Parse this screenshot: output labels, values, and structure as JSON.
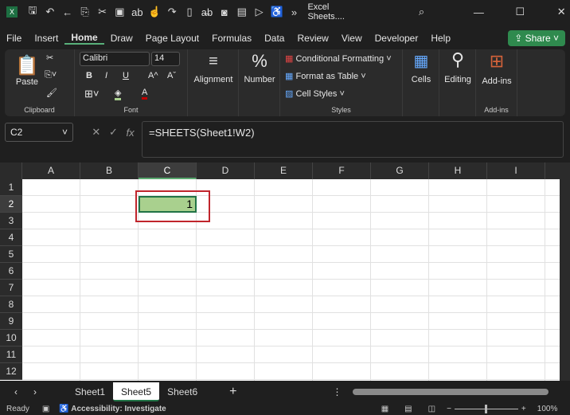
{
  "title_bar": {
    "app_icon": "excel-icon",
    "title": "Excel Sheets....",
    "quick_access": [
      "save-icon",
      "undo-icon",
      "back-icon",
      "copy-icon",
      "cut-icon",
      "image-icon",
      "spelling-icon",
      "touch-icon",
      "redo-icon",
      "new-icon",
      "strikethrough-icon",
      "camera-icon",
      "form-icon",
      "format-icon",
      "accessibility-icon"
    ],
    "more": "»"
  },
  "menu": {
    "items": [
      "File",
      "Insert",
      "Home",
      "Draw",
      "Page Layout",
      "Formulas",
      "Data",
      "Review",
      "View",
      "Developer",
      "Help"
    ],
    "active": "Home",
    "share": "Share"
  },
  "ribbon": {
    "clipboard": {
      "paste": "Paste",
      "label": "Clipboard"
    },
    "font": {
      "name": "Calibri",
      "size": "14",
      "bold": "B",
      "italic": "I",
      "underline": "U",
      "grow": "A^",
      "shrink": "Aˇ",
      "font_color": "A",
      "label": "Font",
      "fill_color": "#a9d08e",
      "text_color": "#c00000"
    },
    "alignment": "Alignment",
    "number": "Number",
    "styles": {
      "items": [
        "Conditional Formatting",
        "Format as Table",
        "Cell Styles"
      ],
      "label": "Styles"
    },
    "cells": "Cells",
    "editing": "Editing",
    "addins": {
      "button": "Add-ins",
      "label": "Add-ins"
    }
  },
  "formula_bar": {
    "name_box": "C2",
    "formula": "=SHEETS(Sheet1!W2)",
    "fx": "fx"
  },
  "grid": {
    "columns": [
      "A",
      "B",
      "C",
      "D",
      "E",
      "F",
      "G",
      "H",
      "I"
    ],
    "rows": [
      "1",
      "2",
      "3",
      "4",
      "5",
      "6",
      "7",
      "8",
      "9",
      "10",
      "11",
      "12"
    ],
    "selected_cell": "C2",
    "cell_value": "1",
    "highlight_color": "#c0252c"
  },
  "sheets": {
    "tabs": [
      "Sheet1",
      "Sheet5",
      "Sheet6"
    ],
    "active": "Sheet5",
    "add": "+"
  },
  "status": {
    "ready": "Ready",
    "accessibility": "Accessibility: Investigate",
    "zoom": "100%",
    "zoom_minus": "−",
    "zoom_plus": "+"
  }
}
